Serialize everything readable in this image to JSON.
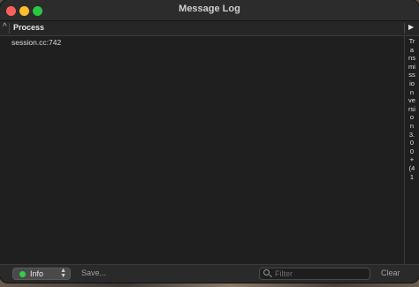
{
  "window": {
    "title": "Message Log"
  },
  "table": {
    "column_process": "Process",
    "rows": [
      {
        "process": "session.cc:742"
      }
    ],
    "message_column_text": "Transmission version 3.00+(41"
  },
  "bottom_bar": {
    "level": "Info",
    "level_color": "#2fcf4a",
    "save_label": "Save...",
    "filter_placeholder": "Filter",
    "filter_value": "",
    "clear_label": "Clear"
  }
}
